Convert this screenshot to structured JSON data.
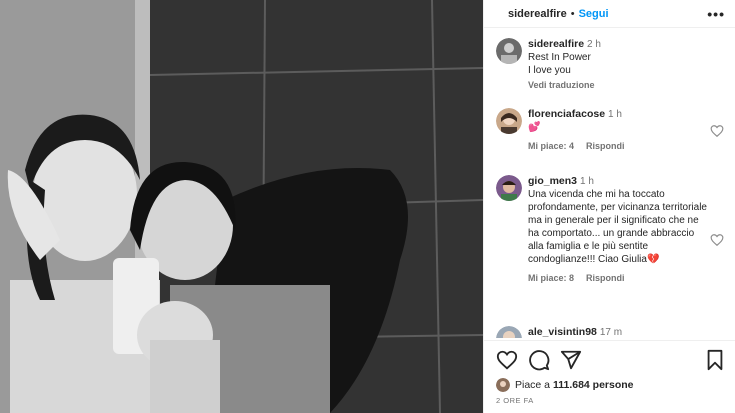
{
  "header": {
    "username": "siderealfire",
    "separator": "•",
    "follow_label": "Segui",
    "more_icon": "more-horizontal-icon"
  },
  "comments": [
    {
      "username": "siderealfire",
      "time": "2 h",
      "lines": [
        "Rest In Power",
        "I love you"
      ],
      "sub": "Vedi traduzione"
    },
    {
      "username": "florenciafacose",
      "time": "1 h",
      "emoji": "💕",
      "likes_label": "Mi piace: 4",
      "reply_label": "Rispondi"
    },
    {
      "username": "gio_men3",
      "time": "1 h",
      "text": "Una vicenda che mi ha toccato profondamente, per vicinanza territoriale ma in generale per il significato che ne ha comportato... un grande abbraccio alla famiglia e le più sentite condoglianze!!! Ciao Giulia💔",
      "likes_label": "Mi piace: 8",
      "reply_label": "Rispondi"
    },
    {
      "username": "ale_visintin98",
      "time": "17 m"
    }
  ],
  "actions": {
    "icons": [
      "heart-icon",
      "comment-icon",
      "share-icon",
      "bookmark-icon"
    ],
    "likes_prefix": "Piace a",
    "likes_count": "111.684 persone",
    "timestamp": "2 ORE FA"
  },
  "colors": {
    "accent": "#0095f6",
    "text": "#262626",
    "muted": "#737373",
    "emoji_heart": "#e0245e"
  }
}
